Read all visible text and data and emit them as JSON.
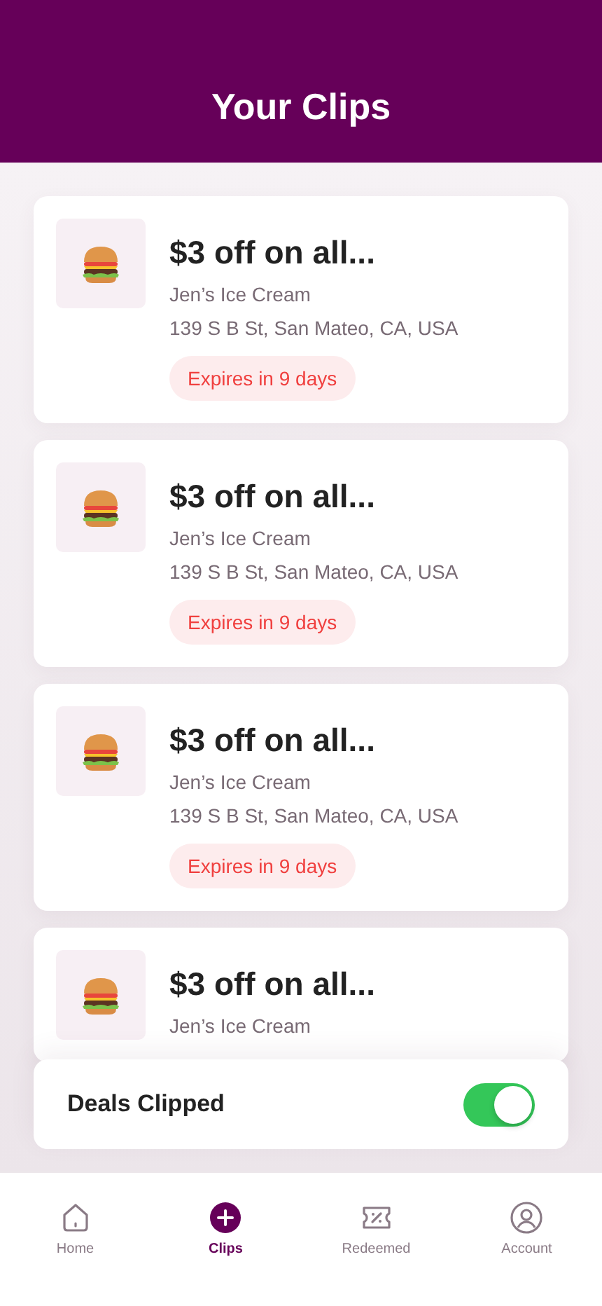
{
  "header": {
    "title": "Your Clips"
  },
  "clips": [
    {
      "title": "$3 off on all...",
      "store": "Jen’s Ice Cream",
      "address": "139 S B St, San Mateo, CA, USA",
      "expiry": "Expires in 9 days"
    },
    {
      "title": "$3 off on all...",
      "store": "Jen’s Ice Cream",
      "address": "139 S B St, San Mateo, CA, USA",
      "expiry": "Expires in 9 days"
    },
    {
      "title": "$3 off on all...",
      "store": "Jen’s Ice Cream",
      "address": "139 S B St, San Mateo, CA, USA",
      "expiry": "Expires in 9 days"
    },
    {
      "title": "$3 off on all...",
      "store": "Jen’s Ice Cream"
    }
  ],
  "deals_clipped": {
    "label": "Deals Clipped",
    "on": true
  },
  "nav": [
    {
      "kind": "home",
      "label": "Home",
      "selected": false
    },
    {
      "kind": "clips",
      "label": "Clips",
      "selected": true
    },
    {
      "kind": "redeemed",
      "label": "Redeemed",
      "selected": false
    },
    {
      "kind": "account",
      "label": "Account",
      "selected": false
    }
  ]
}
